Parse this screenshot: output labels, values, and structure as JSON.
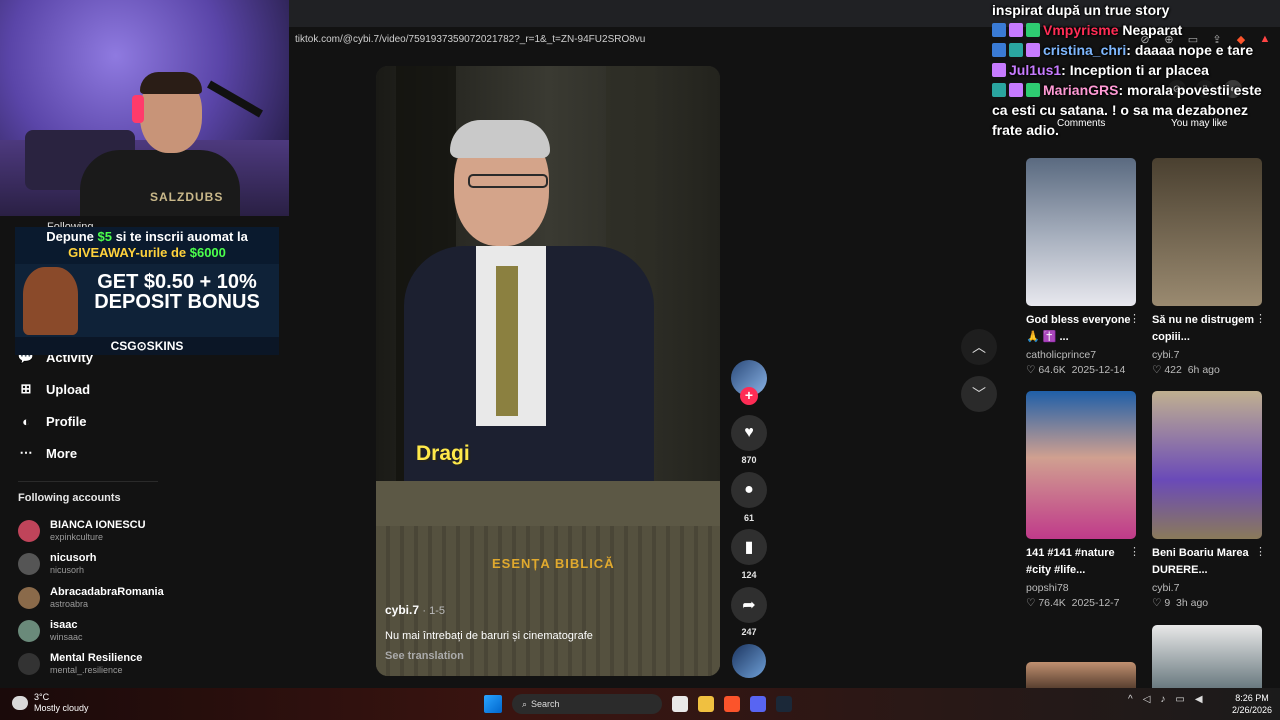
{
  "browser": {
    "url": "tiktok.com/@cybi.7/video/7591937359072021782?_r=1&_t=ZN-94FU2SRO8vu"
  },
  "sidebar": {
    "following_label": "Following",
    "nav": [
      {
        "label": "Activity",
        "icon": "activity-icon"
      },
      {
        "label": "Upload",
        "icon": "upload-icon"
      },
      {
        "label": "Profile",
        "icon": "profile-icon"
      },
      {
        "label": "More",
        "icon": "more-icon"
      }
    ],
    "following_accounts_title": "Following accounts",
    "accounts": [
      {
        "name": "BIANCA IONESCU",
        "handle": "expinkculture",
        "color": "#c0445a"
      },
      {
        "name": "nicusorh",
        "handle": "nicusorh",
        "color": "#555555"
      },
      {
        "name": "AbracadabraRomania",
        "handle": "astroabra",
        "color": "#8a6a4a"
      },
      {
        "name": "isaac",
        "handle": "winsaac",
        "color": "#6a8a7a"
      },
      {
        "name": "Mental Resilience",
        "handle": "mental_.resilience",
        "color": "#333333"
      }
    ]
  },
  "webcam": {
    "shirt_text": "SALZDUBS"
  },
  "ad": {
    "line1_pre": "Depune ",
    "line1_amount": "$5",
    "line1_post": " si te inscrii auomat la",
    "line2_pre": "GIVEAWAY-urile de ",
    "line2_amount": "$6000",
    "main_line1": "GET $0.50 + 10%",
    "main_line2": "DEPOSIT BONUS",
    "brand": "CSG⊙SKINS"
  },
  "video": {
    "caption": "Dragi",
    "watermark": "ESENȚA BIBLICĂ",
    "author": "cybi.7",
    "date": "1-5",
    "description": "Nu mai întrebați de baruri și cinematografe",
    "see_translation": "See translation",
    "likes": "870",
    "comments": "61",
    "saves": "124",
    "shares": "247"
  },
  "right_panel": {
    "tab_comments": "Comments",
    "tab_you_may_like": "You may like",
    "cards": [
      {
        "title": "God bless everyone 🙏 ✝️ ...",
        "user": "catholicprince7",
        "likes": "64.6K",
        "time": "2025-12-14",
        "colorA": "#5a6a80",
        "colorB": "#e8e8ee"
      },
      {
        "title": "Să nu ne distrugem copiii...",
        "user": "cybi.7",
        "likes": "422",
        "time": "6h ago",
        "colorA": "#4a4030",
        "colorB": "#9a8a70"
      },
      {
        "title": "141 #141 #nature #city #life...",
        "user": "popshi78",
        "likes": "76.4K",
        "time": "2025-12-7",
        "colorA": "#1f5fa8",
        "colorB": "#c03a8a"
      },
      {
        "title": "Beni Boariu Marea DURERE...",
        "user": "cybi.7",
        "likes": "9",
        "time": "3h ago",
        "colorA": "#8a7a5a",
        "colorB": "#6a4ab8"
      }
    ]
  },
  "chat": [
    {
      "user": "",
      "message": "inspirat după un true story"
    },
    {
      "user": "Vmpyrisme",
      "message": "Neaparat"
    },
    {
      "user": "cristina_chri",
      "message": "daaaa nope e tare"
    },
    {
      "user": "Jul1us1",
      "message": "Inception ti ar placea"
    },
    {
      "user": "MarianGRS",
      "message": "morala povestii este ca esti cu satana. ! o sa ma dezabonez frate adio."
    }
  ],
  "taskbar": {
    "temp": "3°C",
    "weather": "Mostly cloudy",
    "search": "Search",
    "time": "8:26 PM",
    "date": "2/26/2026"
  }
}
